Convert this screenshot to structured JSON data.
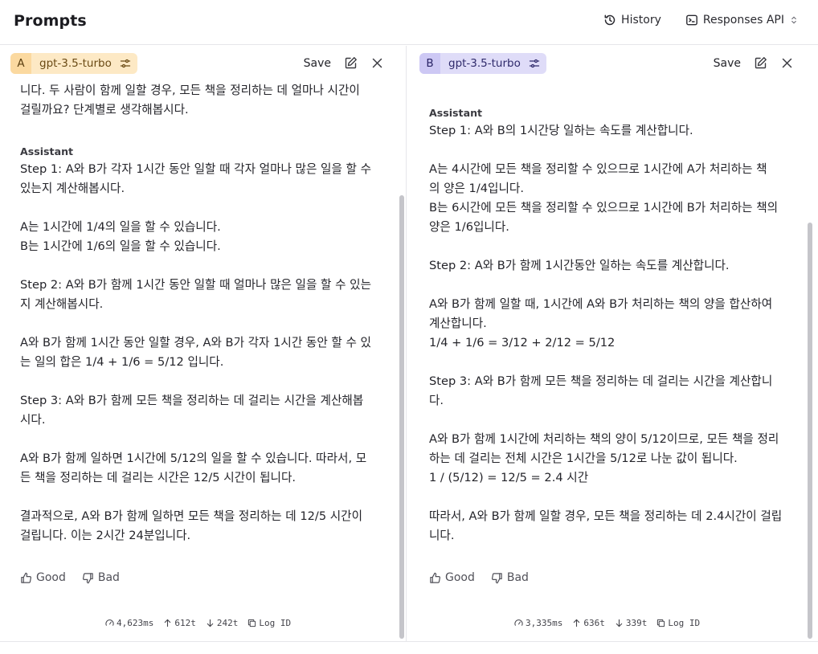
{
  "app": {
    "title": "Prompts"
  },
  "topbar": {
    "history_label": "History",
    "api_label": "Responses API"
  },
  "panel_a": {
    "letter": "A",
    "model": "gpt-3.5-turbo",
    "save_label": "Save",
    "user_text": "니다. 두 사람이 함께 일할 경우, 모든 책을 정리하는 데 얼마나 시간이\n걸릴까요? 단계별로 생각해봅시다.",
    "assistant_label": "Assistant",
    "assistant_text": "Step 1: A와 B가 각자 1시간 동안 일할 때 각자 얼마나 많은 일을 할 수\n있는지 계산해봅시다.\n\nA는 1시간에 1/4의 일을 할 수 있습니다.\nB는 1시간에 1/6의 일을 할 수 있습니다.\n\nStep 2: A와 B가 함께 1시간 동안 일할 때 얼마나 많은 일을 할 수 있는\n지 계산해봅시다.\n\nA와 B가 함께 1시간 동안 일할 경우, A와 B가 각자 1시간 동안 할 수 있\n는 일의 합은 1/4 + 1/6 = 5/12 입니다.\n\nStep 3: A와 B가 함께 모든 책을 정리하는 데 걸리는 시간을 계산해봅\n시다.\n\nA와 B가 함께 일하면 1시간에 5/12의 일을 할 수 있습니다. 따라서, 모\n든 책을 정리하는 데 걸리는 시간은 12/5 시간이 됩니다.\n\n결과적으로, A와 B가 함께 일하면 모든 책을 정리하는 데 12/5 시간이\n걸립니다. 이는 2시간 24분입니다.",
    "good_label": "Good",
    "bad_label": "Bad",
    "latency": "4,623ms",
    "tokens_in": "612t",
    "tokens_out": "242t",
    "log_label": "Log ID"
  },
  "panel_b": {
    "letter": "B",
    "model": "gpt-3.5-turbo",
    "save_label": "Save",
    "assistant_label": "Assistant",
    "assistant_text": "Step 1: A와 B의 1시간당 일하는 속도를 계산합니다.\n\nA는 4시간에 모든 책을 정리할 수 있으므로 1시간에 A가 처리하는 책\n의 양은 1/4입니다.\nB는 6시간에 모든 책을 정리할 수 있으므로 1시간에 B가 처리하는 책의\n양은 1/6입니다.\n\nStep 2: A와 B가 함께 1시간동안 일하는 속도를 계산합니다.\n\nA와 B가 함께 일할 때, 1시간에 A와 B가 처리하는 책의 양을 합산하여\n계산합니다.\n1/4 + 1/6 = 3/12 + 2/12 = 5/12\n\nStep 3: A와 B가 함께 모든 책을 정리하는 데 걸리는 시간을 계산합니\n다.\n\nA와 B가 함께 1시간에 처리하는 책의 양이 5/12이므로, 모든 책을 정리\n하는 데 걸리는 전체 시간은 1시간을 5/12로 나눈 값이 됩니다.\n1 / (5/12) = 12/5 = 2.4 시간\n\n따라서, A와 B가 함께 일할 경우, 모든 책을 정리하는 데 2.4시간이 걸립\n니다.",
    "good_label": "Good",
    "bad_label": "Bad",
    "latency": "3,335ms",
    "tokens_in": "636t",
    "tokens_out": "339t",
    "log_label": "Log ID"
  },
  "colors": {
    "chip_a_bg": "#fde9c5",
    "chip_b_bg": "#dfdcf8",
    "border": "#e6e6ea",
    "scrollbar": "#c5c5ca"
  }
}
